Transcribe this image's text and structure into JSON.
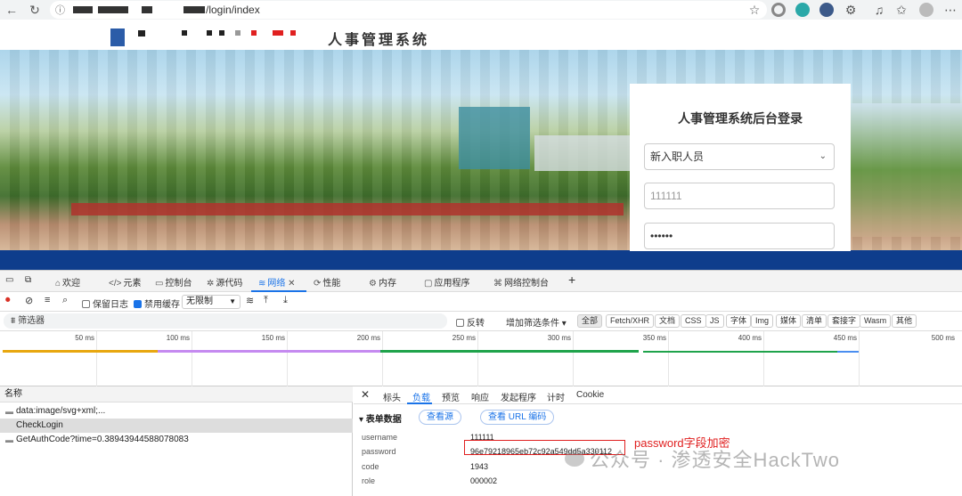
{
  "browser": {
    "url": "/login/index",
    "back": "←",
    "refresh": "↻"
  },
  "site": {
    "title": "人事管理系统"
  },
  "login": {
    "heading": "人事管理系统后台登录",
    "role_select": "新入职人员",
    "username_value": "111111",
    "password_value": "••••••"
  },
  "devtools": {
    "tabs": [
      {
        "icon": "⌂",
        "label": "欢迎"
      },
      {
        "icon": "</>",
        "label": "元素"
      },
      {
        "icon": "▭",
        "label": "控制台"
      },
      {
        "icon": "✲",
        "label": "源代码"
      },
      {
        "icon": "≋",
        "label": "网络"
      },
      {
        "icon": "⟳",
        "label": "性能"
      },
      {
        "icon": "⚙",
        "label": "内存"
      },
      {
        "icon": "▢",
        "label": "应用程序"
      },
      {
        "icon": "⌘",
        "label": "网络控制台"
      }
    ],
    "add_tab": "+",
    "toolbar": {
      "preserve_log": "保留日志",
      "disable_cache": "禁用缓存",
      "throttle": "无限制"
    },
    "filter": {
      "placeholder": "筛选器",
      "invert": "反转",
      "more_filters": "增加筛选条件 ▾",
      "types": [
        "全部",
        "Fetch/XHR",
        "文档",
        "CSS",
        "JS",
        "字体",
        "Img",
        "媒体",
        "清单",
        "套接字",
        "Wasm",
        "其他"
      ]
    },
    "timeline": {
      "ticks": [
        "50 ms",
        "100 ms",
        "150 ms",
        "200 ms",
        "250 ms",
        "300 ms",
        "350 ms",
        "400 ms",
        "450 ms",
        "500 ms"
      ]
    },
    "requests": {
      "header": "名称",
      "rows": [
        "data:image/svg+xml;...",
        "CheckLogin",
        "GetAuthCode?time=0.38943944588078083"
      ]
    },
    "payload": {
      "close": "✕",
      "tabs": [
        "标头",
        "负载",
        "预览",
        "响应",
        "发起程序",
        "计时",
        "Cookie"
      ],
      "section": "▾ 表单数据",
      "view_source": "查看源",
      "view_url": "查看 URL 编码",
      "fields": [
        {
          "key": "username",
          "value": "111111"
        },
        {
          "key": "password",
          "value": "96e79218965eb72c92a549dd5a330112"
        },
        {
          "key": "code",
          "value": "1943"
        },
        {
          "key": "role",
          "value": "000002"
        }
      ]
    }
  },
  "annotation": "password字段加密",
  "watermark": "公众号 · 渗透安全HackTwo",
  "colors": {
    "accent": "#1a73e8",
    "annotation_red": "#e02020",
    "band_blue": "#0e3d8c"
  }
}
